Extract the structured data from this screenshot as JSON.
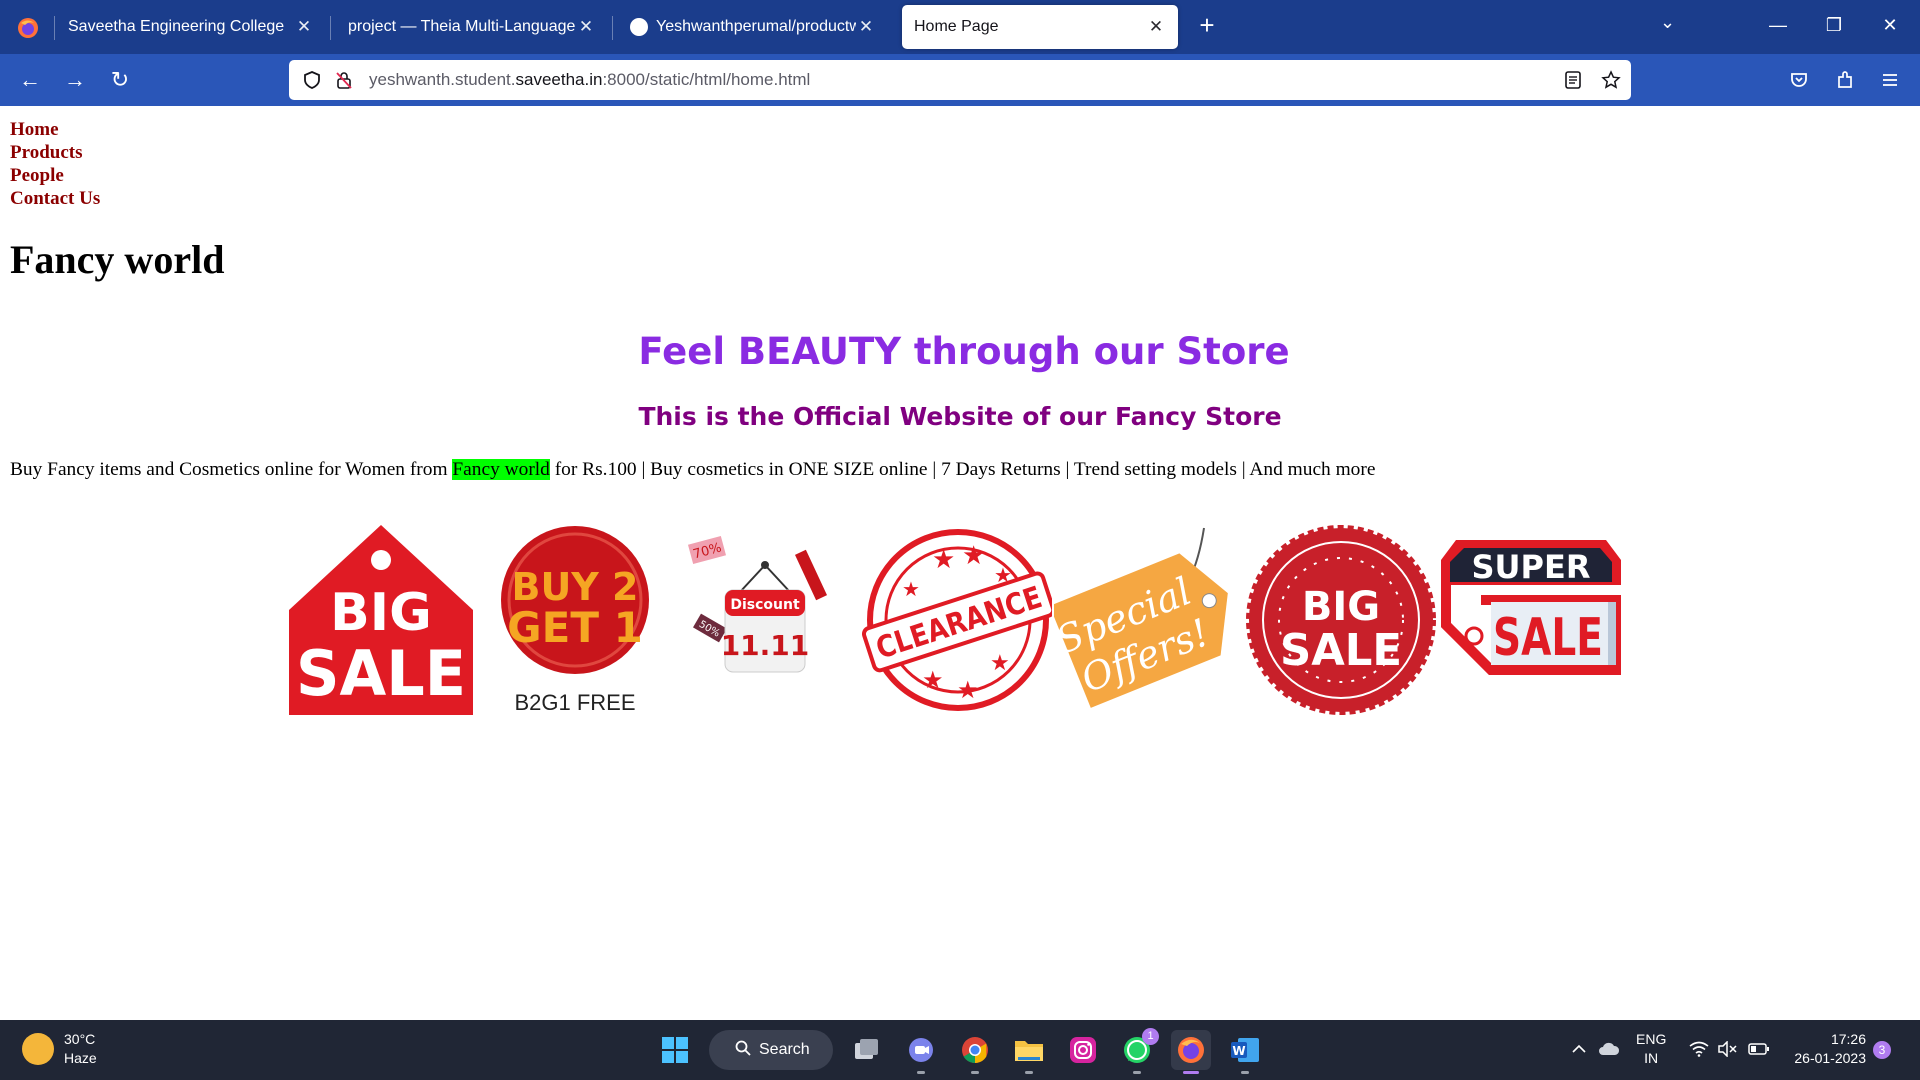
{
  "browser": {
    "tabs": [
      {
        "title": "Saveetha Engineering College",
        "active": false
      },
      {
        "title": "project — Theia Multi-Language Ex",
        "active": false
      },
      {
        "title": "Yeshwanthperumal/productweb",
        "active": false
      },
      {
        "title": "Home Page",
        "active": true
      }
    ],
    "url": {
      "prefix": "yeshwanth.student.",
      "domain": "saveetha.in",
      "suffix": ":8000/static/html/home.html"
    },
    "colors": {
      "tabbar": "#1b3d8c",
      "navbar": "#2a56b8"
    }
  },
  "page": {
    "nav": [
      "Home",
      "Products",
      "People",
      "Contact Us"
    ],
    "site_title": "Fancy world",
    "headline": "Feel BEAUTY through our Store",
    "subheadline": "This is the Official Website of our Fancy Store",
    "tagline": {
      "before": "Buy Fancy items and Cosmetics online for Women from ",
      "highlight": "Fancy world",
      "after": " for Rs.100 | Buy cosmetics in ONE SIZE online | 7 Days Returns | Trend setting models | And much more"
    },
    "badges": {
      "big_sale": {
        "line1": "BIG",
        "line2": "SALE"
      },
      "buy2get1": {
        "line1": "BUY 2",
        "line2": "GET 1",
        "caption": "B2G1 FREE"
      },
      "discount": {
        "label": "Discount",
        "date": "11.11",
        "tag1": "70%",
        "tag2": "50%"
      },
      "clearance": {
        "label": "CLEARANCE"
      },
      "special_offers": {
        "line1": "Special",
        "line2": "Offers!"
      },
      "big_sale_seal": {
        "line1": "BIG",
        "line2": "SALE"
      },
      "super_sale": {
        "line1": "SUPER",
        "line2": "SALE"
      }
    },
    "colors": {
      "nav_link": "#8b0000",
      "headline": "#8a2be2",
      "subheadline": "#800080",
      "highlight": "#00ff00"
    }
  },
  "taskbar": {
    "weather": {
      "temp": "30°C",
      "condition": "Haze"
    },
    "search_label": "Search",
    "whatsapp_badge": "1",
    "language": {
      "line1": "ENG",
      "line2": "IN"
    },
    "clock": {
      "time": "17:26",
      "date": "26-01-2023"
    },
    "notification_count": "3"
  }
}
